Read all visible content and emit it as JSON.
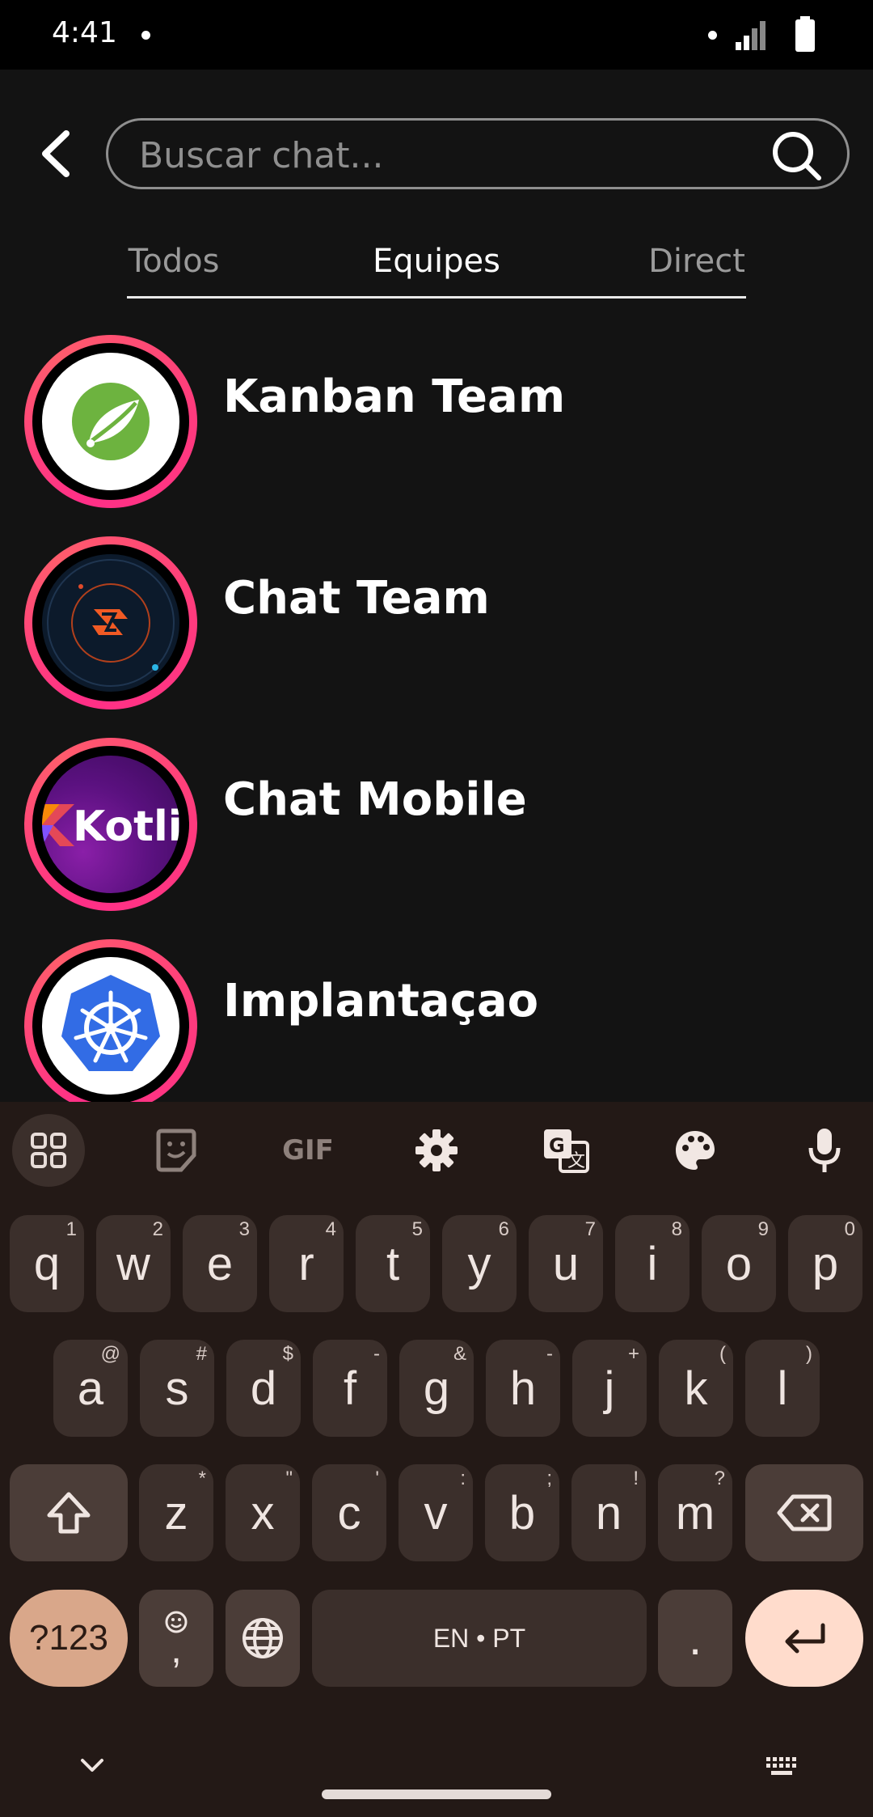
{
  "status_bar": {
    "time": "4:41"
  },
  "header": {
    "search_placeholder": "Buscar chat..."
  },
  "tabs": [
    {
      "label": "Todos",
      "active": false
    },
    {
      "label": "Equipes",
      "active": true
    },
    {
      "label": "Direct",
      "active": false
    }
  ],
  "chats": [
    {
      "name": "Kanban Team",
      "logo": "spring-leaf-icon"
    },
    {
      "name": "Chat Team",
      "logo": "orbit-logo-icon"
    },
    {
      "name": "Chat Mobile",
      "logo": "kotlin-logo",
      "logo_text": "Kotlin"
    },
    {
      "name": "Implantaçao",
      "logo": "kubernetes-wheel-icon"
    }
  ],
  "keyboard": {
    "row1": [
      {
        "k": "q",
        "h": "1"
      },
      {
        "k": "w",
        "h": "2"
      },
      {
        "k": "e",
        "h": "3"
      },
      {
        "k": "r",
        "h": "4"
      },
      {
        "k": "t",
        "h": "5"
      },
      {
        "k": "y",
        "h": "6"
      },
      {
        "k": "u",
        "h": "7"
      },
      {
        "k": "i",
        "h": "8"
      },
      {
        "k": "o",
        "h": "9"
      },
      {
        "k": "p",
        "h": "0"
      }
    ],
    "row2": [
      {
        "k": "a",
        "h": "@"
      },
      {
        "k": "s",
        "h": "#"
      },
      {
        "k": "d",
        "h": "$"
      },
      {
        "k": "f",
        "h": "-"
      },
      {
        "k": "g",
        "h": "&"
      },
      {
        "k": "h",
        "h": "-"
      },
      {
        "k": "j",
        "h": "+"
      },
      {
        "k": "k",
        "h": "("
      },
      {
        "k": "l",
        "h": ")"
      }
    ],
    "row3": [
      {
        "k": "z",
        "h": "*"
      },
      {
        "k": "x",
        "h": "\""
      },
      {
        "k": "c",
        "h": "'"
      },
      {
        "k": "v",
        "h": ":"
      },
      {
        "k": "b",
        "h": ";"
      },
      {
        "k": "n",
        "h": "!"
      },
      {
        "k": "m",
        "h": "?"
      }
    ],
    "symbols_label": "?123",
    "comma_label": ",",
    "space_label": "EN • PT",
    "period_label": ".",
    "toolbar_gif": "GIF"
  },
  "colors": {
    "ring": "#ff2f87",
    "keyboard_bg": "#231916",
    "key_bg": "#3b2f2b",
    "enter_bg": "#ffdccc",
    "symbols_bg": "#d9a78a"
  }
}
